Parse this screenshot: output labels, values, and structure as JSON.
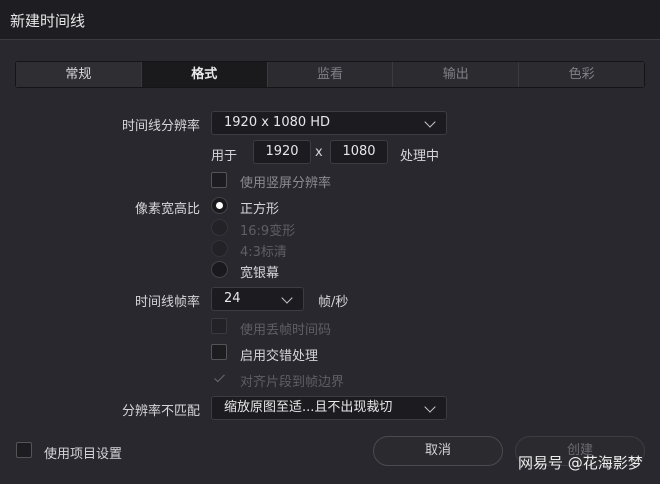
{
  "window": {
    "title": "新建时间线"
  },
  "tabs": [
    {
      "label": "常规"
    },
    {
      "label": "格式"
    },
    {
      "label": "监看"
    },
    {
      "label": "输出"
    },
    {
      "label": "色彩"
    }
  ],
  "resolution": {
    "label": "时间线分辨率",
    "value": "1920 x 1080 HD",
    "use_for_prefix": "用于",
    "width": "1920",
    "separator": "x",
    "height": "1080",
    "processing_suffix": "处理中",
    "vertical_label": "使用竖屏分辨率"
  },
  "pixel_aspect": {
    "label": "像素宽高比",
    "options": [
      {
        "label": "正方形",
        "selected": true,
        "enabled": true
      },
      {
        "label": "16:9变形",
        "selected": false,
        "enabled": false
      },
      {
        "label": "4:3标清",
        "selected": false,
        "enabled": false
      },
      {
        "label": "宽银幕",
        "selected": false,
        "enabled": true
      }
    ]
  },
  "frame_rate": {
    "label": "时间线帧率",
    "value": "24",
    "unit": "帧/秒",
    "drop_frame_label": "使用丢帧时间码",
    "interlace_label": "启用交错处理",
    "align_label": "对齐片段到帧边界"
  },
  "mismatch": {
    "label": "分辨率不匹配",
    "value": "缩放原图至适...且不出现裁切"
  },
  "footer": {
    "use_project_settings": "使用项目设置",
    "cancel": "取消",
    "create": "创建"
  },
  "watermark": "网易号 @花海影梦",
  "colors": {
    "background": "#28282e",
    "accent": "#ffffff"
  }
}
